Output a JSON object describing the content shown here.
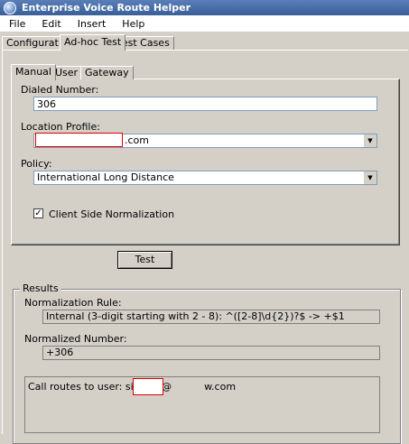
{
  "window": {
    "title": "Enterprise Voice Route Helper"
  },
  "menu": [
    "File",
    "Edit",
    "Insert",
    "Help"
  ],
  "outer_tabs": [
    "Configuration",
    "Ad-hoc Test",
    "Test Cases"
  ],
  "inner_tabs": [
    "Manual",
    "User",
    "Gateway"
  ],
  "manual": {
    "dialed_number_label": "Dialed Number:",
    "dialed_number_value": "306",
    "location_profile_label": "Location Profile:",
    "location_profile_suffix": ".com",
    "policy_label": "Policy:",
    "policy_value": "International Long Distance",
    "client_side_normalization_label": "Client Side Normalization",
    "client_side_normalization_checked": true
  },
  "test_button_label": "Test",
  "results": {
    "title": "Results",
    "normalization_rule_label": "Normalization Rule:",
    "normalization_rule_value": "Internal (3-digit starting with 2 - 8): ^([2-8]\\d{2})?$  ->  +$1",
    "normalized_number_label": "Normalized Number:",
    "normalized_number_value": "+306",
    "call_routes_prefix": "Call routes to user: sip:tluk@",
    "call_routes_suffix": "w.com"
  }
}
